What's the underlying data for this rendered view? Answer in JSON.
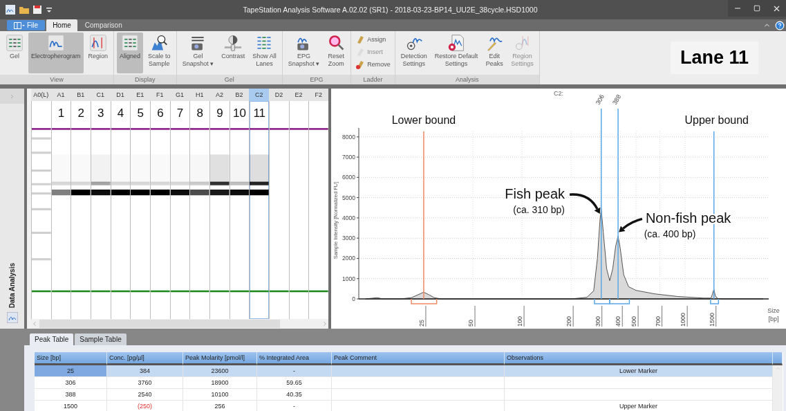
{
  "window": {
    "title": "TapeStation Analysis Software A.02.02 (SR1) - 2018-03-23-BP14_UU2E_38cycle.HSD1000"
  },
  "file_button": {
    "label": "File"
  },
  "menu_tabs": [
    {
      "label": "Home",
      "selected": true
    },
    {
      "label": "Comparison",
      "selected": false
    }
  ],
  "ribbon": {
    "groups": [
      {
        "label": "View",
        "items": [
          {
            "lines": [
              "Gel"
            ],
            "selected": false,
            "disabled": false
          },
          {
            "lines": [
              "Electropherogram"
            ],
            "selected": true,
            "disabled": false
          },
          {
            "lines": [
              "Region"
            ],
            "selected": false,
            "disabled": false
          }
        ]
      },
      {
        "label": "Display",
        "items": [
          {
            "lines": [
              "Aligned"
            ],
            "selected": true,
            "disabled": false
          },
          {
            "lines": [
              "Scale to",
              "Sample"
            ],
            "selected": false,
            "disabled": false
          }
        ]
      },
      {
        "label": "Gel",
        "items": [
          {
            "lines": [
              "Gel",
              "Snapshot ▾"
            ],
            "selected": false,
            "disabled": false
          },
          {
            "lines": [
              "Contrast"
            ],
            "selected": false,
            "disabled": false
          },
          {
            "lines": [
              "Show All",
              "Lanes"
            ],
            "selected": false,
            "disabled": false
          }
        ]
      },
      {
        "label": "EPG",
        "items": [
          {
            "lines": [
              "EPG",
              "Snapshot ▾"
            ],
            "selected": false,
            "disabled": false
          },
          {
            "lines": [
              "Reset",
              "Zoom"
            ],
            "selected": false,
            "disabled": false
          }
        ]
      },
      {
        "label": "Ladder",
        "kind": "small",
        "items": [
          {
            "lines": [
              "Assign"
            ],
            "selected": false,
            "disabled": false
          },
          {
            "lines": [
              "Insert"
            ],
            "selected": false,
            "disabled": true
          },
          {
            "lines": [
              "Remove"
            ],
            "selected": false,
            "disabled": false
          }
        ]
      },
      {
        "label": "Analysis",
        "items": [
          {
            "lines": [
              "Detection",
              "Settings"
            ],
            "selected": false,
            "disabled": false
          },
          {
            "lines": [
              "Restore Default",
              "Settings"
            ],
            "selected": false,
            "disabled": false
          },
          {
            "lines": [
              "Edit",
              "Peaks"
            ],
            "selected": false,
            "disabled": false
          },
          {
            "lines": [
              "Region",
              "Settings"
            ],
            "selected": false,
            "disabled": true
          }
        ]
      }
    ]
  },
  "lane_label": "Lane 11",
  "side_strip": {
    "label": "Data Analysis"
  },
  "gel": {
    "lanes": [
      {
        "well": "A0(L)",
        "selected": false
      },
      {
        "well": "A1",
        "number": "1",
        "selected": false
      },
      {
        "well": "B1",
        "number": "2",
        "selected": false
      },
      {
        "well": "C1",
        "number": "3",
        "selected": false
      },
      {
        "well": "D1",
        "number": "4",
        "selected": false
      },
      {
        "well": "E1",
        "number": "5",
        "selected": false
      },
      {
        "well": "F1",
        "number": "6",
        "selected": false
      },
      {
        "well": "G1",
        "number": "7",
        "selected": false
      },
      {
        "well": "H1",
        "number": "8",
        "selected": false
      },
      {
        "well": "A2",
        "number": "9",
        "selected": false
      },
      {
        "well": "B2",
        "number": "10",
        "selected": false
      },
      {
        "well": "C2",
        "number": "11",
        "selected": true
      },
      {
        "well": "D2",
        "selected": false
      },
      {
        "well": "E2",
        "selected": false
      },
      {
        "well": "F2",
        "selected": false
      }
    ]
  },
  "electropherogram": {
    "title": "C2:",
    "y_axis_title": "Sample Intensity [Normalized FU]",
    "x_axis_title": "Size [bp]",
    "y_tick_labels": [
      "8000",
      "7000",
      "6000",
      "5000",
      "4000",
      "3000",
      "2000",
      "1000",
      "0"
    ],
    "x_tick_labels": [
      "25",
      "50",
      "100",
      "200",
      "300",
      "400",
      "500",
      "700",
      "1000",
      "1500"
    ],
    "peak_labels": [
      "306",
      "388"
    ],
    "annotations": [
      "Lower bound",
      "Upper bound",
      "Fish peak",
      "(ca. 310 bp)",
      "Non-fish peak",
      "(ca. 400 bp)"
    ]
  },
  "bottom_tabs": [
    {
      "label": "Peak Table",
      "selected": true
    },
    {
      "label": "Sample Table",
      "selected": false
    }
  ],
  "peak_table": {
    "columns": [
      "Size [bp]",
      "Conc. [pg/µl]",
      "Peak Molarity [pmol/l]",
      "% Integrated Area",
      "Peak Comment",
      "Observations"
    ],
    "rows": [
      {
        "size": "25",
        "conc": "384",
        "molarity": "23600",
        "area": "-",
        "observations": "Lower Marker",
        "selected": true,
        "conc_flagged": false
      },
      {
        "size": "306",
        "conc": "3760",
        "molarity": "18900",
        "area": "59.65",
        "selected": false,
        "conc_flagged": false
      },
      {
        "size": "388",
        "conc": "2540",
        "molarity": "10100",
        "area": "40.35",
        "selected": false,
        "conc_flagged": false
      },
      {
        "size": "1500",
        "conc": "(250)",
        "molarity": "256",
        "area": "-",
        "observations": "Upper Marker",
        "selected": false,
        "conc_flagged": true
      }
    ]
  }
}
